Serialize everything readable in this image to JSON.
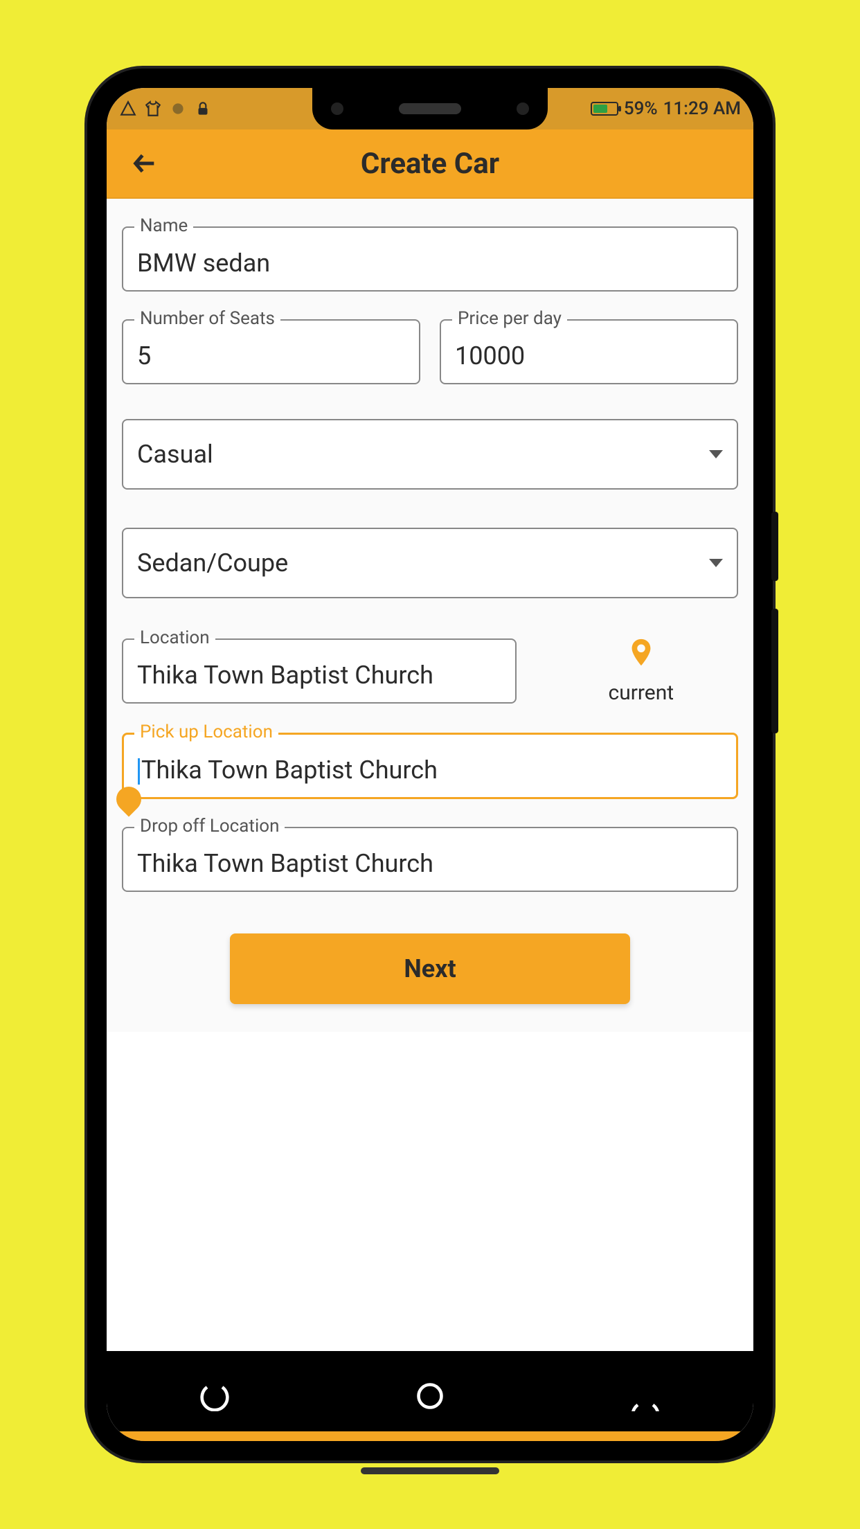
{
  "statusBar": {
    "battery": "59%",
    "time": "11:29 AM"
  },
  "header": {
    "title": "Create Car"
  },
  "form": {
    "name": {
      "label": "Name",
      "value": "BMW sedan"
    },
    "seats": {
      "label": "Number of Seats",
      "value": "5"
    },
    "price": {
      "label": "Price per day",
      "value": "10000"
    },
    "styleSelect": {
      "value": "Casual"
    },
    "typeSelect": {
      "value": "Sedan/Coupe"
    },
    "location": {
      "label": "Location",
      "value": "Thika Town Baptist Church"
    },
    "currentLabel": "current",
    "pickup": {
      "label": "Pick up Location",
      "value": "Thika Town Baptist Church"
    },
    "dropoff": {
      "label": "Drop off Location",
      "value": "Thika Town Baptist Church"
    },
    "nextButton": "Next"
  }
}
